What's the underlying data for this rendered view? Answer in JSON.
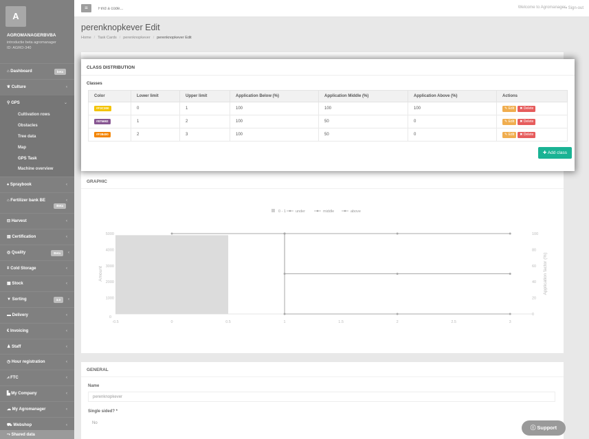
{
  "sidebar": {
    "avatar_letter": "A",
    "company": "AGROMANAGERBVBA",
    "subtitle": "introductie beta agromanager",
    "id": "ID: AGRO-340",
    "items": [
      {
        "label": "Dashboard",
        "icon": "home-icon",
        "badge": "beta"
      },
      {
        "label": "Culture",
        "icon": "leaf-icon",
        "chevron": "‹"
      },
      {
        "label": "GPS",
        "icon": "map-pin-icon",
        "chevron": "⌄"
      },
      {
        "label": "Spraybook",
        "icon": "spray-icon",
        "chevron": "‹"
      },
      {
        "label": "Fertilizer bank BE",
        "icon": "bank-icon",
        "chevron": "‹",
        "badge": "Beta"
      },
      {
        "label": "Harvest",
        "icon": "basket-icon",
        "chevron": "‹"
      },
      {
        "label": "Certification",
        "icon": "certificate-icon",
        "chevron": "‹"
      },
      {
        "label": "Quality",
        "icon": "quality-icon",
        "badge": "Beta",
        "chevron": "‹"
      },
      {
        "label": "Cold Storage",
        "icon": "thermometer-icon",
        "chevron": "‹"
      },
      {
        "label": "Stock",
        "icon": "stock-icon",
        "chevron": "‹"
      },
      {
        "label": "Sorting",
        "icon": "filter-icon",
        "badge": "3.0",
        "chevron": "‹"
      },
      {
        "label": "Delivery",
        "icon": "truck-icon",
        "chevron": "‹"
      },
      {
        "label": "Invoicing",
        "icon": "euro-icon",
        "chevron": "‹"
      },
      {
        "label": "Staff",
        "icon": "user-icon",
        "chevron": "‹"
      },
      {
        "label": "Hour registration",
        "icon": "clock-icon",
        "chevron": "‹"
      },
      {
        "label": "FTC",
        "icon": "chart-icon",
        "chevron": "‹"
      },
      {
        "label": "My Company",
        "icon": "building-icon",
        "chevron": "‹"
      },
      {
        "label": "My Agromanager",
        "icon": "cloud-icon",
        "chevron": "‹"
      },
      {
        "label": "Webshop",
        "icon": "cart-icon",
        "chevron": "‹"
      },
      {
        "label": "Shared data",
        "icon": "share-icon"
      }
    ],
    "gps_sub": [
      "Cultivation rows",
      "Obstacles",
      "Tree data",
      "Map",
      "GPS Task",
      "Machine overview"
    ]
  },
  "topbar": {
    "search_placeholder": "Find a code...",
    "welcome": "Welcome to Agromanager",
    "signout": "Sign-out"
  },
  "page": {
    "title": "perenknopkever Edit",
    "breadcrumb": [
      "Home",
      "Task Cards",
      "perenknopkever",
      "perenknopkever Edit"
    ]
  },
  "class_distribution": {
    "title": "CLASS DISTRIBUTION",
    "subtitle": "Classes",
    "columns": [
      "Color",
      "Lower limit",
      "Upper limit",
      "Application Below (%)",
      "Application Middle (%)",
      "Application Above (%)",
      "Actions"
    ],
    "rows": [
      {
        "color": "#F3C300",
        "lower": "0",
        "upper": "1",
        "below": "100",
        "middle": "100",
        "above": "100"
      },
      {
        "color": "#875692",
        "lower": "1",
        "upper": "2",
        "below": "100",
        "middle": "50",
        "above": "0"
      },
      {
        "color": "#F38400",
        "lower": "2",
        "upper": "3",
        "below": "100",
        "middle": "50",
        "above": "0"
      }
    ],
    "edit_label": "Edit",
    "delete_label": "Delete",
    "add_label": "Add class"
  },
  "graphic": {
    "title": "GRAPHIC"
  },
  "chart_data": {
    "type": "line",
    "legend": [
      "0 - 1",
      "under",
      "middle",
      "above"
    ],
    "legend_position": "top",
    "xlim": [
      -0.5,
      3.2
    ],
    "x_ticks": [
      "-0.5",
      "0",
      "0.5",
      "1",
      "1.5",
      "2",
      "2.5",
      "3"
    ],
    "ylabel": "Amount",
    "ylim": [
      0,
      5000
    ],
    "y_ticks": [
      "0",
      "1000",
      "2000",
      "3000",
      "4000",
      "5000"
    ],
    "y2label": "Application factor (%)",
    "y2lim": [
      0,
      100
    ],
    "y2_ticks": [
      "0",
      "20",
      "40",
      "60",
      "80",
      "100"
    ],
    "bar": {
      "name": "0 - 1",
      "x_range": [
        -0.5,
        0.5
      ],
      "value": 4900
    },
    "series": [
      {
        "name": "above",
        "points": [
          [
            0,
            100
          ],
          [
            1,
            100
          ],
          [
            1,
            0
          ],
          [
            2,
            0
          ],
          [
            3,
            0
          ]
        ]
      },
      {
        "name": "middle",
        "points": [
          [
            1,
            100
          ],
          [
            1,
            50
          ],
          [
            2,
            50
          ],
          [
            3,
            50
          ]
        ]
      },
      {
        "name": "under",
        "points": [
          [
            1,
            100
          ],
          [
            2,
            100
          ],
          [
            3,
            100
          ]
        ]
      }
    ]
  },
  "general": {
    "title": "GENERAL",
    "name_label": "Name",
    "name_value": "perenknopkever",
    "single_sided_label": "Single sided? *",
    "single_sided_value": "No"
  },
  "support": {
    "label": "Support"
  }
}
